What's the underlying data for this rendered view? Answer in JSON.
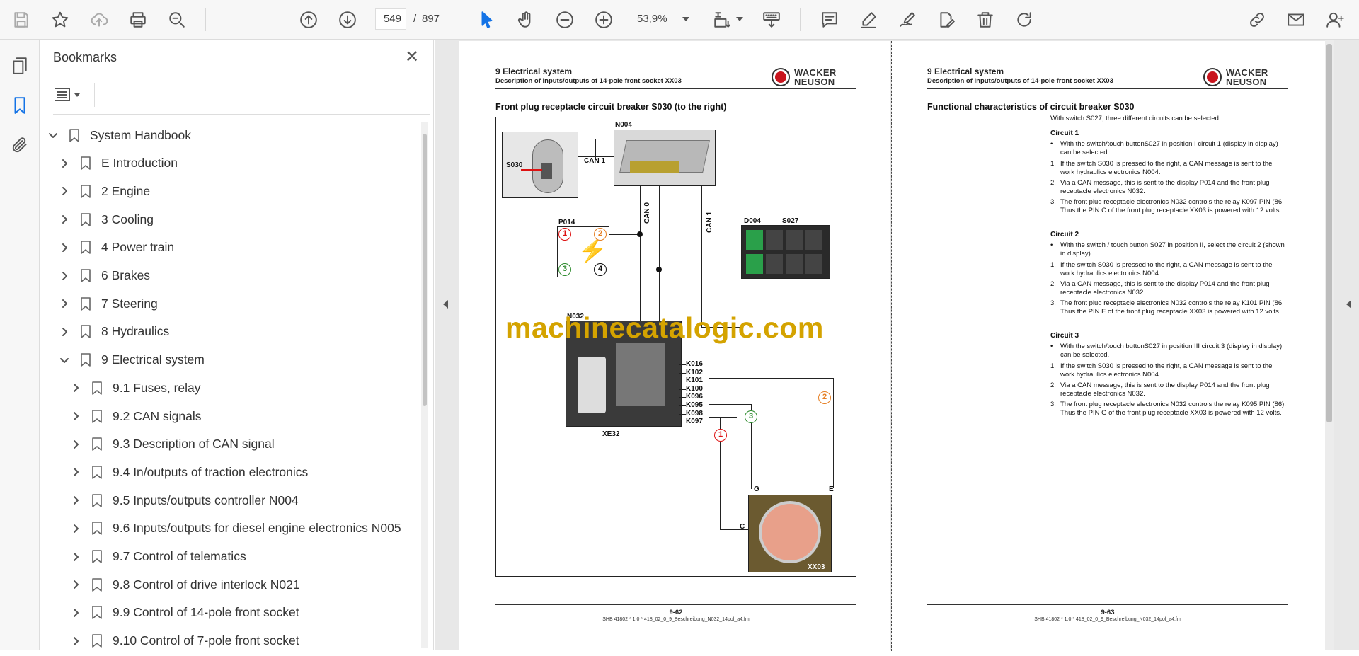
{
  "toolbar": {
    "current_page": "549",
    "page_separator": "/",
    "total_pages": "897",
    "zoom": "53,9%"
  },
  "panel": {
    "title": "Bookmarks",
    "close_glyph": "✕"
  },
  "bookmarks": [
    {
      "label": "System Handbook",
      "level": 0,
      "expanded": true
    },
    {
      "label": "E Introduction",
      "level": 1
    },
    {
      "label": "2 Engine",
      "level": 1
    },
    {
      "label": "3 Cooling",
      "level": 1
    },
    {
      "label": "4 Power train",
      "level": 1
    },
    {
      "label": "6 Brakes",
      "level": 1
    },
    {
      "label": "7 Steering",
      "level": 1
    },
    {
      "label": "8 Hydraulics",
      "level": 1
    },
    {
      "label": "9 Electrical system",
      "level": 1,
      "expanded": true
    },
    {
      "label": "9.1 Fuses, relay",
      "level": 2,
      "underline": true
    },
    {
      "label": "9.2 CAN signals",
      "level": 2
    },
    {
      "label": "9.3 Description of CAN signal",
      "level": 2
    },
    {
      "label": "9.4 In/outputs of traction electronics",
      "level": 2
    },
    {
      "label": "9.5 Inputs/outputs controller N004",
      "level": 2
    },
    {
      "label": "9.6 Inputs/outputs for diesel engine electronics N005",
      "level": 2
    },
    {
      "label": "9.7 Control of telematics",
      "level": 2
    },
    {
      "label": "9.8 Control of drive interlock N021",
      "level": 2
    },
    {
      "label": "9.9 Control of 14-pole front socket",
      "level": 2
    },
    {
      "label": "9.10 Control of 7-pole front socket",
      "level": 2
    }
  ],
  "left_page": {
    "chapter": "9   Electrical system",
    "subtitle": "Description of inputs/outputs of 14-pole front socket XX03",
    "logo": [
      "WACKER",
      "NEUSON"
    ],
    "section_title": "Front plug receptacle circuit breaker S030 (to the right)",
    "diagram": {
      "labels": {
        "n004": "N004",
        "s030": "S030",
        "can1a": "CAN 1",
        "can0": "CAN 0",
        "can1b": "CAN 1",
        "p014": "P014",
        "d004": "D004",
        "s027": "S027",
        "n032": "N032",
        "xe32": "XE32",
        "g": "G",
        "e": "E",
        "c": "C",
        "xx03": "XX03"
      },
      "p014_circles": [
        "1",
        "2",
        "3",
        "4"
      ],
      "relays": [
        "K016",
        "K102",
        "K101",
        "K100",
        "K096",
        "K095",
        "K098",
        "K097"
      ],
      "circuit_circles": [
        "1",
        "2",
        "3"
      ]
    },
    "watermark": "machinecatalogic.com",
    "page_num": "9-62",
    "file": "SHB 41802 * 1.0 * 418_02_0_9_Beschreibung_N032_14pol_a4.fm"
  },
  "right_page": {
    "chapter": "9   Electrical system",
    "subtitle": "Description of inputs/outputs of 14-pole front socket XX03",
    "logo": [
      "WACKER",
      "NEUSON"
    ],
    "section_title": "Functional characteristics of circuit breaker S030",
    "intro": "With switch S027, three different circuits can be selected.",
    "circuits": [
      {
        "head": "Circuit 1",
        "bullet": "With the switch/touch buttonS027 in position I circuit 1 (display in display) can be selected.",
        "steps": [
          "If the switch S030 is pressed to the right, a CAN message is sent to the work hydraulics electronics N004.",
          "Via a CAN message, this is sent to the display P014 and the front plug receptacle electronics N032.",
          "The front plug receptacle electronics N032 controls the relay K097 PIN (86. Thus the PIN C of the front plug receptacle XX03 is powered with 12 volts."
        ]
      },
      {
        "head": "Circuit 2",
        "bullet": "With the switch / touch button S027 in position II, select the circuit 2 (shown in display).",
        "steps": [
          "If the switch S030 is pressed to the right, a CAN message is sent to the work hydraulics electronics N004.",
          "Via a CAN message, this is sent to the display P014 and the front plug receptacle electronics N032.",
          "The front plug receptacle electronics N032 controls the relay K101 PIN (86. Thus the PIN E of the front plug receptacle XX03 is powered with 12 volts."
        ]
      },
      {
        "head": "Circuit 3",
        "bullet": "With the switch/touch buttonS027 in position III circuit 3 (display in display) can be selected.",
        "steps": [
          "If the switch S030 is pressed to the right, a CAN message is sent to the work hydraulics electronics N004.",
          "Via a CAN message, this is sent to the display P014 and the front plug receptacle electronics N032.",
          "The front plug receptacle electronics N032 controls the relay K095 PIN (86). Thus the PIN G of the front plug receptacle XX03 is powered with 12 volts."
        ]
      }
    ],
    "page_num": "9-63",
    "file": "SHB 41802 * 1.0 * 418_02_0_9_Beschreibung_N032_14pol_a4.fm"
  }
}
